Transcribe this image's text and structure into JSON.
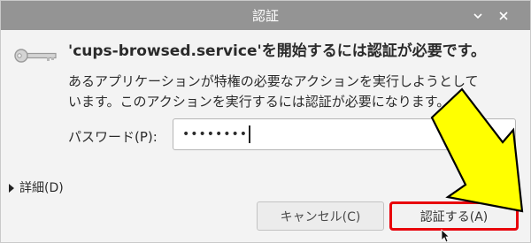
{
  "window": {
    "title": "認証"
  },
  "dialog": {
    "heading": "'cups-browsed.service'を開始するには認証が必要です。",
    "message_line1": "あるアプリケーションが特権の必要なアクションを実行しようとして",
    "message_line2": "います。このアクションを実行するには認証が必要になります。"
  },
  "password": {
    "label": "パスワード(P):",
    "value": "••••••••"
  },
  "details": {
    "label": "詳細(D)"
  },
  "buttons": {
    "cancel_label": "キャンセル(C)",
    "authenticate_label": "認証する(A)"
  },
  "icons": {
    "key": "key-icon",
    "minimize": "minimize-icon",
    "close": "close-icon",
    "pointer": "cursor-icon",
    "annotation_arrow": "yellow-arrow"
  },
  "colors": {
    "titlebar": "#949494",
    "highlight_border": "#e8000b",
    "arrow_fill": "#ffff00",
    "arrow_stroke": "#000000"
  }
}
